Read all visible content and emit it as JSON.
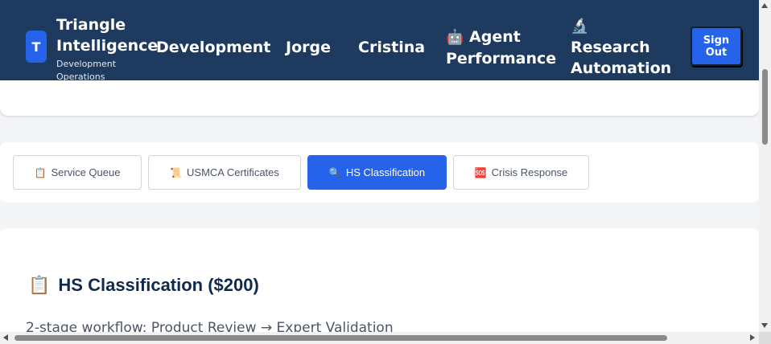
{
  "header": {
    "logo_letter": "T",
    "brand_name": "Triangle Intelligence",
    "brand_subtitle": "Development Operations",
    "nav": [
      {
        "label": "Development",
        "icon": ""
      },
      {
        "label": "Jorge",
        "icon": ""
      },
      {
        "label": "Cristina",
        "icon": ""
      },
      {
        "label": "Agent Performance",
        "icon": "robot-icon",
        "glyph": "🤖"
      },
      {
        "label": "Research Automation",
        "icon": "microscope-icon",
        "glyph": "🔬"
      }
    ],
    "signout_label": "Sign Out"
  },
  "tabs": [
    {
      "label": "Service Queue",
      "glyph": "📋",
      "icon": "clipboard-icon",
      "active": false
    },
    {
      "label": "USMCA Certificates",
      "glyph": "📜",
      "icon": "scroll-icon",
      "active": false
    },
    {
      "label": "HS Classification",
      "glyph": "🔍",
      "icon": "magnifier-icon",
      "active": true
    },
    {
      "label": "Crisis Response",
      "glyph": "🆘",
      "icon": "sos-icon",
      "active": false
    }
  ],
  "main": {
    "title_glyph": "📋",
    "title": "HS Classification ($200)",
    "subtitle": "2-stage workflow: Product Review → Expert Validation"
  },
  "colors": {
    "header_bg": "#1e3a5f",
    "accent": "#2563eb",
    "page_bg": "#f3f4f6"
  }
}
